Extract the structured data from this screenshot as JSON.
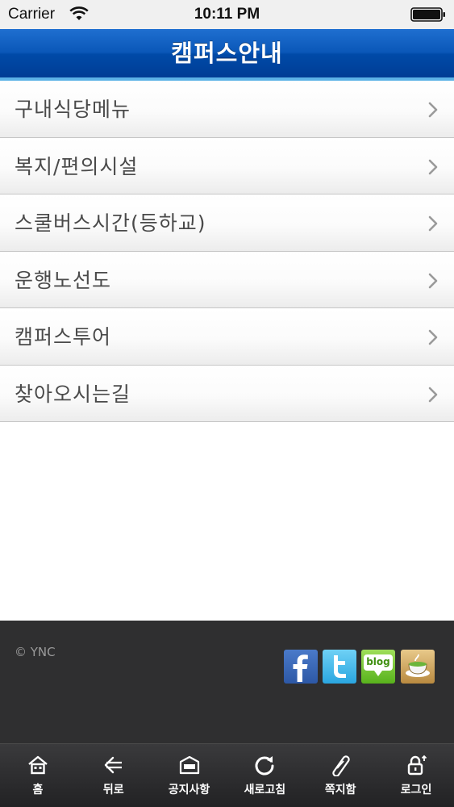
{
  "status_bar": {
    "carrier": "Carrier",
    "time": "10:11 PM"
  },
  "nav": {
    "title": "캠퍼스안내"
  },
  "menu": {
    "items": [
      {
        "label": "구내식당메뉴"
      },
      {
        "label": "복지/편의시설"
      },
      {
        "label": "스쿨버스시간(등하교)"
      },
      {
        "label": "운행노선도"
      },
      {
        "label": "캠퍼스투어"
      },
      {
        "label": "찾아오시는길"
      }
    ]
  },
  "footer": {
    "copyright": "© YNC",
    "social": [
      {
        "icon": "facebook-icon",
        "color": "#3b5998"
      },
      {
        "icon": "twitter-icon",
        "color": "#33b5e5"
      },
      {
        "icon": "blog-icon",
        "label": "blog",
        "color": "#6cc12f"
      },
      {
        "icon": "cafe-icon",
        "color": "#c89b50"
      }
    ]
  },
  "tab_bar": {
    "tabs": [
      {
        "label": "홈",
        "icon": "home-icon"
      },
      {
        "label": "뒤로",
        "icon": "back-arrow-icon"
      },
      {
        "label": "공지사항",
        "icon": "notice-icon"
      },
      {
        "label": "새로고침",
        "icon": "refresh-icon"
      },
      {
        "label": "쪽지함",
        "icon": "memo-icon"
      },
      {
        "label": "로그인",
        "icon": "lock-icon"
      }
    ]
  },
  "colors": {
    "nav_blue": "#0a57b8",
    "nav_accent": "#5cb2e6",
    "footer_bg": "#2f2f30",
    "tab_bg": "#2a2a2c"
  }
}
